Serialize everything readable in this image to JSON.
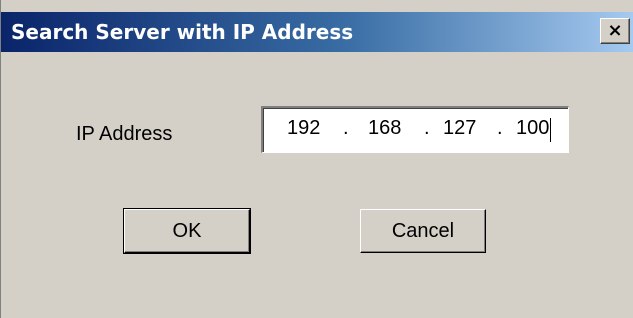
{
  "dialog": {
    "title": "Search Server with IP Address",
    "close_glyph": "×",
    "ip_label": "IP Address",
    "ip_address": {
      "octets": [
        "192",
        "168",
        "127",
        "100"
      ],
      "separator": "."
    },
    "buttons": {
      "ok_label": "OK",
      "cancel_label": "Cancel"
    }
  },
  "colors": {
    "title_gradient_start": "#0a246a",
    "title_gradient_end": "#a6caf0",
    "dialog_background": "#d4d0c8"
  },
  "icons": {
    "close": "close-icon"
  }
}
